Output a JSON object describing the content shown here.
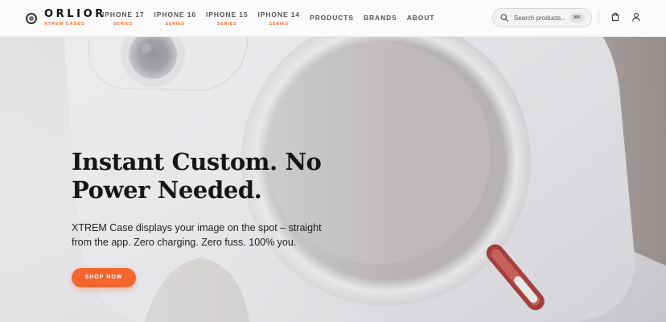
{
  "brand": {
    "name": "ORLIOR",
    "tagline": "XTREM CASES"
  },
  "nav": {
    "series": [
      {
        "label": "IPHONE 17",
        "sub": "SERIES"
      },
      {
        "label": "IPHONE 16",
        "sub": "SERIES"
      },
      {
        "label": "IPHONE 15",
        "sub": "SERIES"
      },
      {
        "label": "IPHONE 14",
        "sub": "SERIES"
      }
    ],
    "links": [
      "PRODUCTS",
      "BRANDS",
      "ABOUT"
    ]
  },
  "search": {
    "placeholder": "Search products...",
    "shortcut": "⌘K"
  },
  "icons": [
    "search-icon",
    "cart-icon",
    "user-icon"
  ],
  "hero": {
    "headline": "Instant Custom. No Power Needed.",
    "subtext": "XTREM Case displays your image on the spot – straight from the app. Zero charging. Zero fuss. 100% you.",
    "cta": "SHOP NOW"
  },
  "colors": {
    "accent": "#f4652c",
    "text": "#161616",
    "header_bg": "#fbfbfb"
  }
}
